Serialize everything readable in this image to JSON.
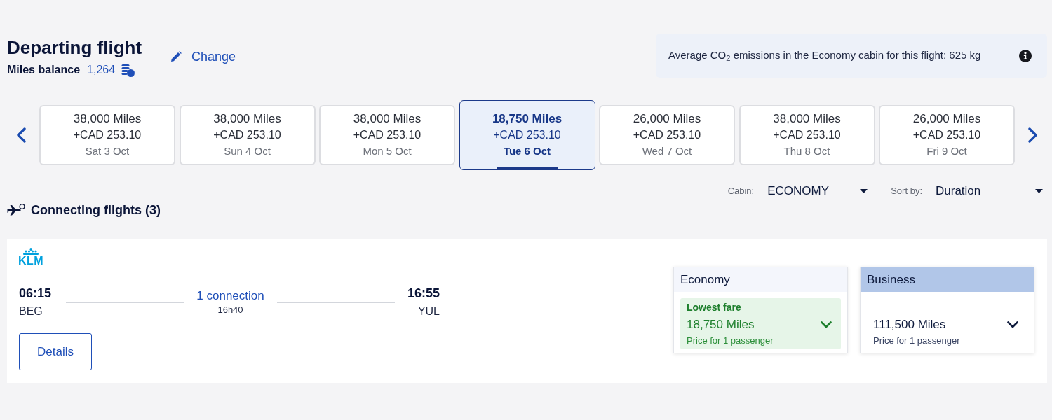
{
  "header": {
    "title": "Departing flight",
    "balance_label": "Miles balance",
    "balance_value": "1,264",
    "change_link": "Change"
  },
  "emissions": {
    "text": "Average CO$_{2}$ emissions in the Economy cabin for this flight: 625 kg"
  },
  "date_carousel": {
    "days": [
      {
        "miles": "38,000 Miles",
        "price": "+CAD 253.10",
        "date": "Sat 3 Oct",
        "selected": false
      },
      {
        "miles": "38,000 Miles",
        "price": "+CAD 253.10",
        "date": "Sun 4 Oct",
        "selected": false
      },
      {
        "miles": "38,000 Miles",
        "price": "+CAD 253.10",
        "date": "Mon 5 Oct",
        "selected": false
      },
      {
        "miles": "18,750 Miles",
        "price": "+CAD 253.10",
        "date": "Tue 6 Oct",
        "selected": true
      },
      {
        "miles": "26,000 Miles",
        "price": "+CAD 253.10",
        "date": "Wed 7 Oct",
        "selected": false
      },
      {
        "miles": "38,000 Miles",
        "price": "+CAD 253.10",
        "date": "Thu 8 Oct",
        "selected": false
      },
      {
        "miles": "26,000 Miles",
        "price": "+CAD 253.10",
        "date": "Fri 9 Oct",
        "selected": false
      }
    ]
  },
  "filters": [
    {
      "label": "Cabin:",
      "value": "ECONOMY"
    },
    {
      "label": "Sort by:",
      "value": "Duration"
    }
  ],
  "results_heading": "Connecting flights (3)",
  "flights": [
    {
      "airline": "KLM",
      "departure_time": "06:15",
      "departure_airport": "BEG",
      "connections": "1 connection",
      "duration": "16h40",
      "arrival_time": "16:55",
      "arrival_airport": "YUL",
      "details_button": "Details",
      "fares": [
        {
          "kind": "economy",
          "cabin": "Economy",
          "tag": "Lowest fare",
          "lowest": true,
          "miles": "18,750 Miles",
          "note": "Price for 1 passenger"
        },
        {
          "kind": "business",
          "cabin": "Business",
          "lowest": false,
          "miles": "111,500 Miles",
          "note": "Price for 1 passenger"
        }
      ]
    }
  ]
}
